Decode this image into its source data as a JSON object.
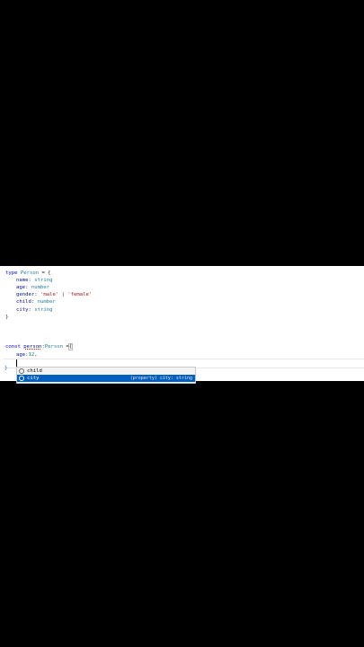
{
  "code": {
    "line1": {
      "kw": "type",
      "name": "Person",
      "rest": " = {"
    },
    "line2": {
      "prop": "name",
      "sep": ": ",
      "type": "string"
    },
    "line3": {
      "prop": "age",
      "sep": ": ",
      "type": "number"
    },
    "line4": {
      "prop": "gender",
      "sep": ": ",
      "s1": "'male'",
      "bar": " | ",
      "s2": "'female'"
    },
    "line5": {
      "prop": "child",
      "sep": ": ",
      "type": "number"
    },
    "line6": {
      "prop": "city",
      "sep": ": ",
      "type": "string"
    },
    "line7": {
      "close": "}"
    },
    "line8": {
      "kw": "const",
      "var": "person",
      "colon": ":",
      "type": "Person",
      "eq": " =",
      "brace": "{"
    },
    "line9": {
      "prop": "age",
      "colon": ":",
      "num": "12",
      "comma": ","
    },
    "line10": {
      "close": "}"
    }
  },
  "suggest": {
    "items": [
      {
        "label": "child",
        "icon": "property-icon",
        "detail": ""
      },
      {
        "label": "city",
        "icon": "property-icon",
        "detail": "(property) city: string",
        "selected": true
      }
    ]
  }
}
